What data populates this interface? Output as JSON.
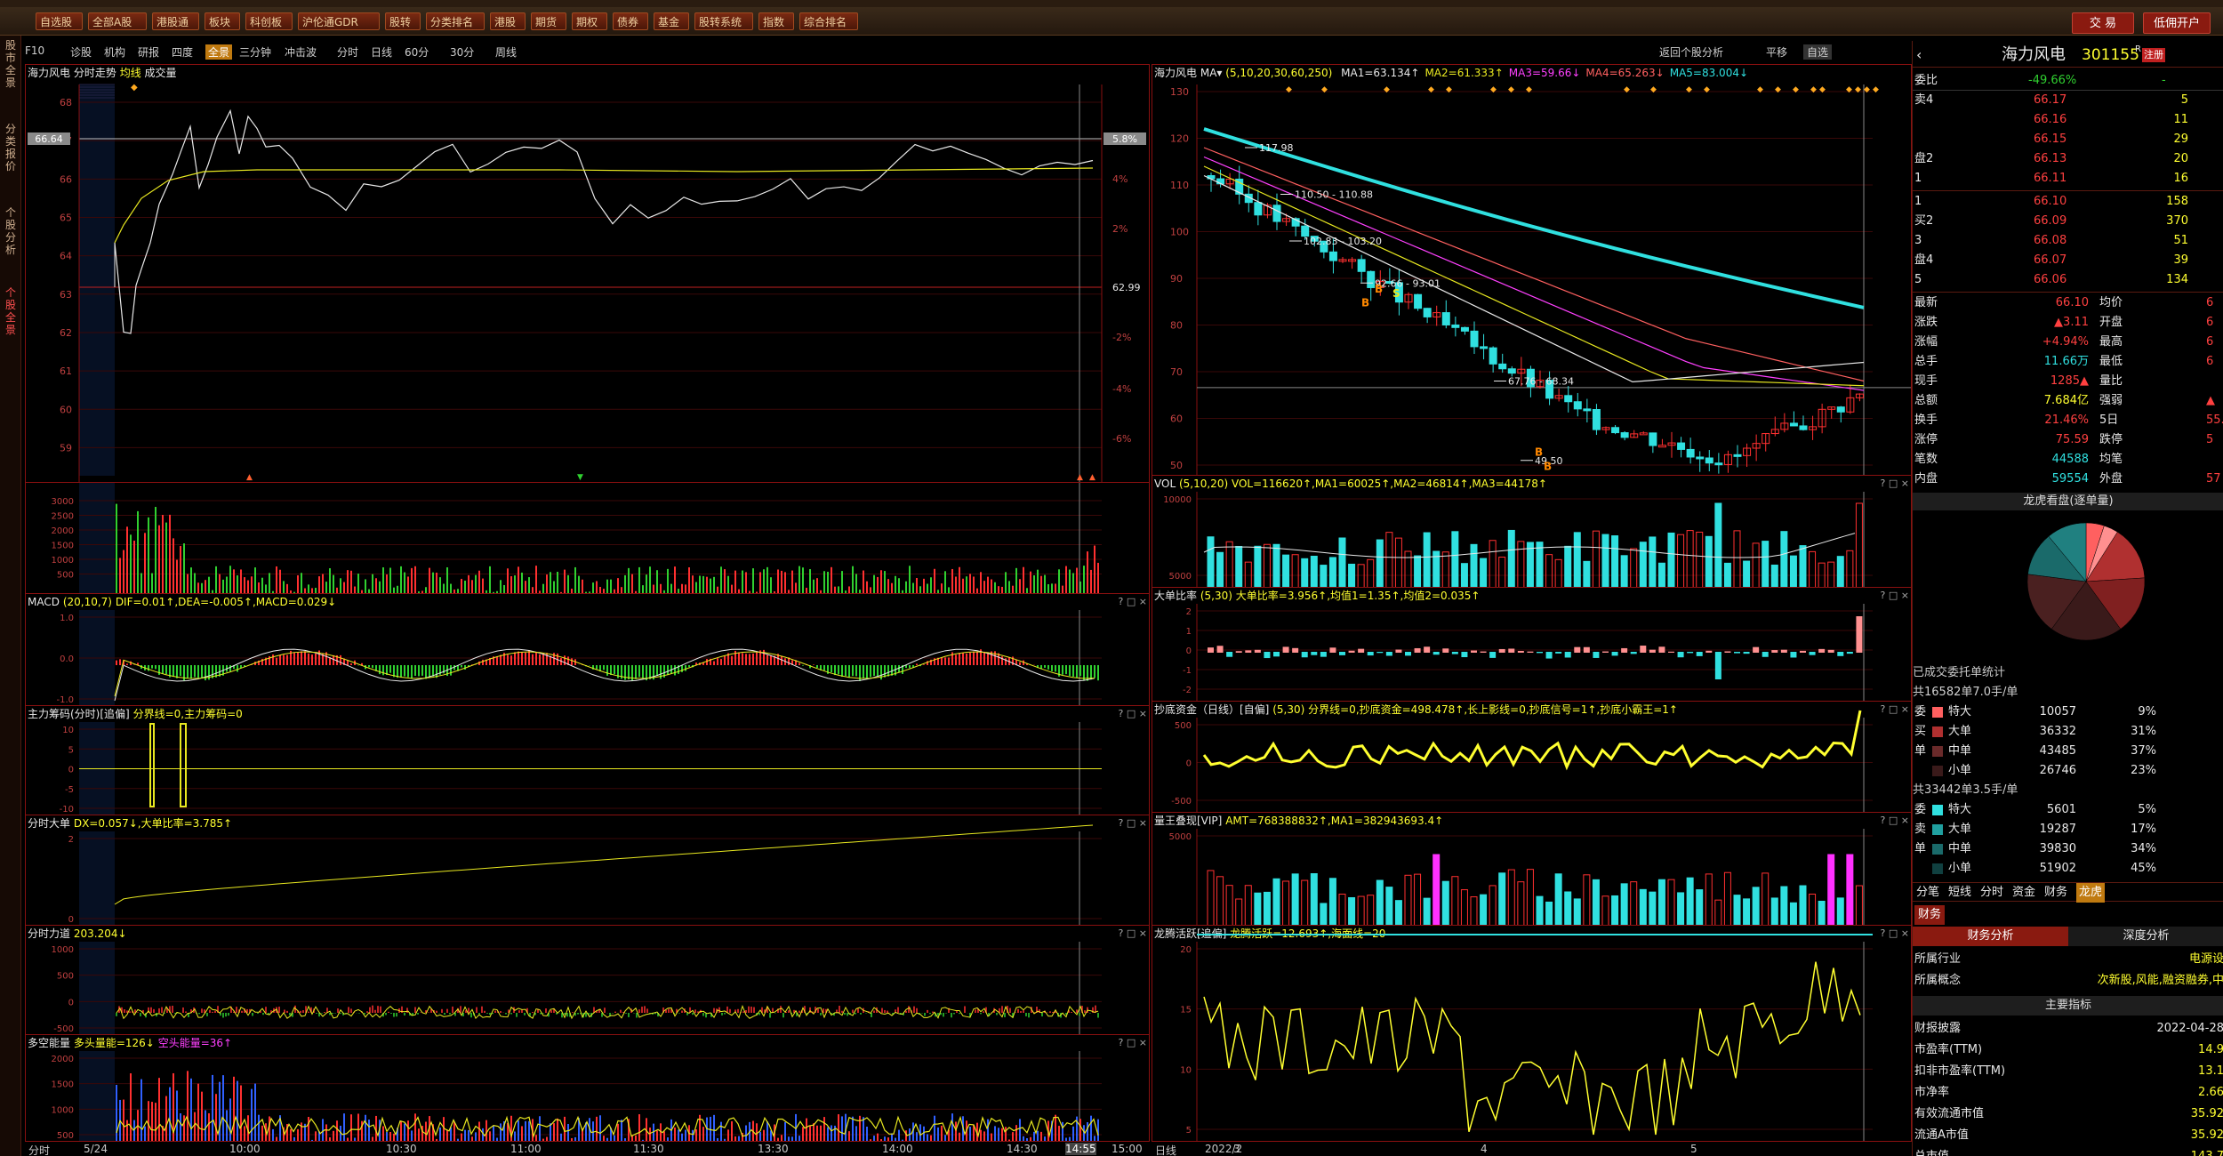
{
  "header": {
    "trade_btn": "交 易",
    "open_btn": "低佣开户"
  },
  "menu": [
    "自选股",
    "全部A股",
    "港股通",
    "板块",
    "科创板",
    "沪伦通GDR",
    "股转",
    "分类排名",
    "港股",
    "期货",
    "期权",
    "债券",
    "基金",
    "股转系统",
    "指数",
    "综合排名"
  ],
  "left_nav": [
    "股市全景",
    "分类报价",
    "个股分析",
    "个股全景"
  ],
  "toolbar": [
    "F10",
    "诊股",
    "机构",
    "研报",
    "四度",
    "全景",
    "三分钟",
    "冲击波",
    "分时",
    "日线",
    "60分",
    "30分",
    "周线"
  ],
  "toolbar_active": "全景",
  "toolbar2": {
    "back": "返回个股分析",
    "flat": "平移",
    "self": "自选"
  },
  "intraday": {
    "title": "海力风电",
    "subtitle": "分时走势",
    "avg_label": "均线",
    "vol_label": "成交量",
    "price_ticks": [
      "68",
      "67",
      "66",
      "65",
      "64",
      "63",
      "62",
      "61",
      "60",
      "59"
    ],
    "pct_ticks": [
      "4%",
      "2%",
      "-2%",
      "-4%",
      "-6%"
    ],
    "cur_price": "66.64",
    "cur_pct": "5.8%",
    "prev_close": "62.99",
    "vol_ticks": [
      "3000",
      "2500",
      "2000",
      "1500",
      "1000",
      "500"
    ],
    "time_ticks": [
      "5/24",
      "10:00",
      "10:30",
      "11:00",
      "11:30",
      "13:30",
      "14:00",
      "14:30",
      "14:55",
      "15:00"
    ],
    "time_label": "分时"
  },
  "panes_left": [
    {
      "label": "MACD",
      "params": "(20,10,7)",
      "values": "DIF=0.01↑,DEA=-0.005↑,MACD=0.029↓",
      "ticks": [
        "1.0",
        "0.0",
        "-1.0"
      ]
    },
    {
      "label": "主力筹码(分时)[追偏]",
      "values": "分界线=0,主力筹码=0",
      "ticks": [
        "10",
        "5",
        "0",
        "-5",
        "-10"
      ]
    },
    {
      "label": "分时大单",
      "values": "DX=0.057↓,大单比率=3.785↑",
      "ticks": [
        "2",
        "0"
      ]
    },
    {
      "label": "分时力道",
      "values": "203.204↓",
      "ticks": [
        "1000",
        "500",
        "0",
        "-500"
      ]
    },
    {
      "label": "多空能量",
      "values": "多头量能=126↓",
      "values2": "空头能量=36↑",
      "ticks": [
        "2000",
        "1500",
        "1000",
        "500"
      ]
    }
  ],
  "kline": {
    "title": "海力风电",
    "ma_params": "(5,10,20,30,60,250)",
    "ma_values": [
      "MA1=63.134↑",
      "MA2=61.333↑",
      "MA3=59.66↓",
      "MA4=65.263↓",
      "MA5=83.004↓"
    ],
    "price_ticks": [
      "130",
      "120",
      "110",
      "100",
      "90",
      "80",
      "70",
      "60",
      "50"
    ],
    "annotations": [
      "117.98",
      "110.50 - 110.88",
      "102.83 - 103.20",
      "92.66 - 93.01",
      "67.76 - 68.34",
      "49.50"
    ],
    "date_ticks": [
      "2022/2",
      "3",
      "4",
      "5"
    ],
    "date_label": "日线"
  },
  "panes_right": [
    {
      "label": "VOL",
      "params": "(5,10,20)",
      "values": "VOL=116620↑,MA1=60025↑,MA2=46814↑,MA3=44178↑",
      "ticks": [
        "10000",
        "5000"
      ]
    },
    {
      "label": "大单比率",
      "params": "(5,30)",
      "values": "大单比率=3.956↑,均值1=1.35↑,均值2=0.035↑",
      "ticks": [
        "2",
        "1",
        "0",
        "-1",
        "-2"
      ]
    },
    {
      "label": "抄底资金（日线）[自偏]",
      "params": "(5,30)",
      "values": "分界线=0,抄底资金=498.478↑,长上影线=0,抄底信号=1↑,抄底小霸王=1↑",
      "ticks": [
        "500",
        "0",
        "-500"
      ]
    },
    {
      "label": "量王叠现[VIP]",
      "values": "AMT=768388832↑,MA1=382943693.4↑",
      "ticks": [
        "5000"
      ]
    },
    {
      "label": "龙腾活跃[追偏]",
      "values": "龙腾活跃=12.693↑,海面线=20",
      "ticks": [
        "20",
        "15",
        "10",
        "5"
      ]
    }
  ],
  "quote": {
    "name": "海力风电",
    "code": "301155",
    "suffix": "R",
    "tag": "注册",
    "weibi_label": "委比",
    "weibi": "-49.66%",
    "weicha": "-",
    "weicha_val": "",
    "asks": [
      {
        "label": "卖4",
        "price": "66.17",
        "vol": "5"
      },
      {
        "label": "",
        "price": "66.16",
        "vol": "11"
      },
      {
        "label": "",
        "price": "66.15",
        "vol": "29"
      },
      {
        "label": "盘2",
        "price": "66.13",
        "vol": "20"
      },
      {
        "label": "1",
        "price": "66.11",
        "vol": "16"
      }
    ],
    "bids": [
      {
        "label": "1",
        "price": "66.10",
        "vol": "158"
      },
      {
        "label": "买2",
        "price": "66.09",
        "vol": "370"
      },
      {
        "label": "3",
        "price": "66.08",
        "vol": "51"
      },
      {
        "label": "盘4",
        "price": "66.07",
        "vol": "39"
      },
      {
        "label": "5",
        "price": "66.06",
        "vol": "134"
      }
    ],
    "stats": [
      {
        "l": "最新",
        "v": "66.10",
        "l2": "均价",
        "v2": "6"
      },
      {
        "l": "涨跌",
        "v": "▲3.11",
        "l2": "开盘",
        "v2": "6"
      },
      {
        "l": "涨幅",
        "v": "+4.94%",
        "l2": "最高",
        "v2": "6"
      },
      {
        "l": "总手",
        "v": "11.66万",
        "l2": "最低",
        "v2": "6"
      },
      {
        "l": "现手",
        "v": "1285▲",
        "l2": "量比",
        "v2": ""
      },
      {
        "l": "总额",
        "v": "7.684亿",
        "l2": "强弱",
        "v2": "▲"
      },
      {
        "l": "换手",
        "v": "21.46%",
        "l2": "5日",
        "v2": "55."
      },
      {
        "l": "涨停",
        "v": "75.59",
        "l2": "跌停",
        "v2": "5"
      },
      {
        "l": "笔数",
        "v": "44588",
        "l2": "均笔",
        "v2": ""
      },
      {
        "l": "内盘",
        "v": "59554",
        "l2": "外盘",
        "v2": "57"
      }
    ],
    "pie_title": "龙虎看盘(逐单量)",
    "pie_slices": [
      {
        "value": 9,
        "color": "#ff6060"
      },
      {
        "value": 31,
        "color": "#b03030"
      },
      {
        "value": 37,
        "color": "#3a1a1a"
      },
      {
        "value": 23,
        "color": "#207070"
      }
    ],
    "order_title": "已成交委托单统计",
    "buy_total": "共16582单7.0手/单",
    "buy_rows": [
      {
        "l": "特大",
        "v": "10057",
        "p": "9%"
      },
      {
        "l": "大单",
        "v": "36332",
        "p": "31%"
      },
      {
        "l": "中单",
        "v": "43485",
        "p": "37%"
      },
      {
        "l": "小单",
        "v": "26746",
        "p": "23%"
      }
    ],
    "buy_side": [
      "委",
      "买",
      "单"
    ],
    "sell_total": "共33442单3.5手/单",
    "sell_rows": [
      {
        "l": "特大",
        "v": "5601",
        "p": "5%"
      },
      {
        "l": "大单",
        "v": "19287",
        "p": "17%"
      },
      {
        "l": "中单",
        "v": "39830",
        "p": "34%"
      },
      {
        "l": "小单",
        "v": "51902",
        "p": "45%"
      }
    ],
    "sell_side": [
      "委",
      "卖",
      "单"
    ],
    "tabs": [
      "分笔",
      "短线",
      "分时",
      "资金",
      "财务",
      "龙虎"
    ],
    "tabs_active": "龙虎",
    "fin_tab": "财务",
    "fin_tabs": [
      "财务分析",
      "深度分析"
    ],
    "fin_rows": [
      {
        "l": "所属行业",
        "v": "电源设"
      },
      {
        "l": "所属概念",
        "v": "次新股,风能,融资融券,中"
      }
    ],
    "main_idx": "主要指标",
    "idx_rows": [
      {
        "l": "财报披露",
        "v": "2022-04-28"
      },
      {
        "l": "市盈率(TTM)",
        "v": "14.9"
      },
      {
        "l": "扣非市盈率(TTM)",
        "v": "13.1"
      },
      {
        "l": "市净率",
        "v": "2.66"
      },
      {
        "l": "有效流通市值",
        "v": "35.92"
      },
      {
        "l": "流通A市值",
        "v": "35.92"
      },
      {
        "l": "总市值",
        "v": "143.7"
      }
    ]
  },
  "colors": {
    "up": "#ff3030",
    "down": "#30e0e0",
    "grid": "#8a1010",
    "yellow": "#ffff30",
    "white": "#e8e8e8"
  }
}
